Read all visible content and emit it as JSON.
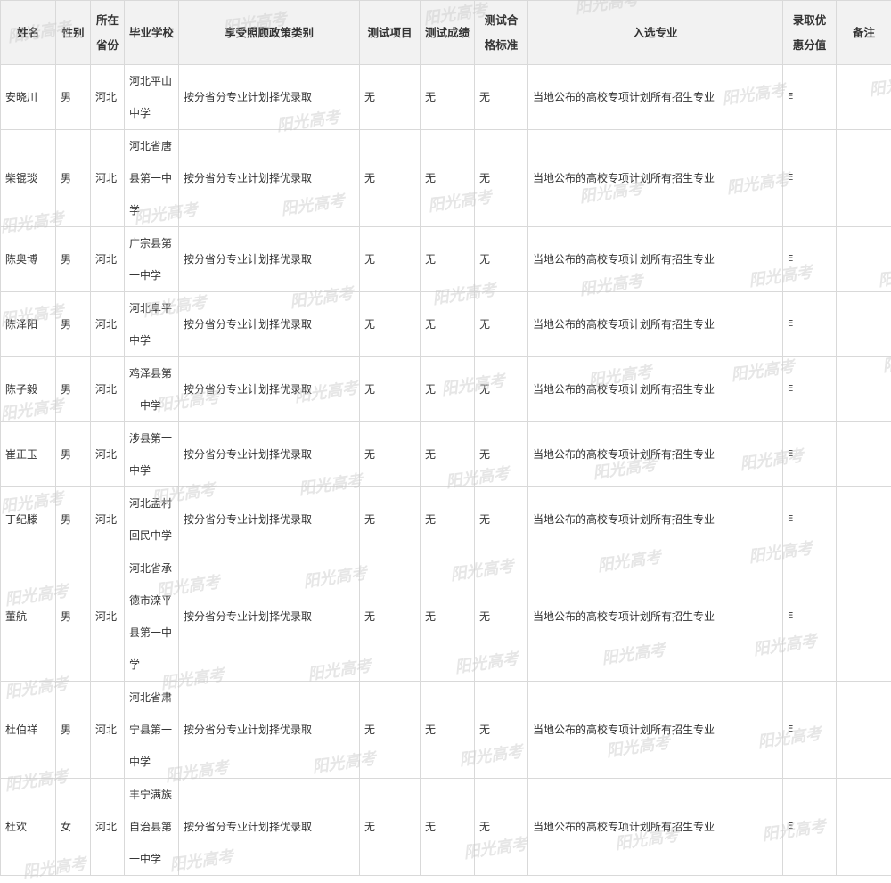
{
  "table": {
    "headers": [
      "姓名",
      "性别",
      "所在省份",
      "毕业学校",
      "享受照顾政策类别",
      "测试项目",
      "测试成绩",
      "测试合格标准",
      "入选专业",
      "录取优惠分值",
      "备注"
    ],
    "rows": [
      [
        "安晓川",
        "男",
        "河北",
        "河北平山中学",
        "按分省分专业计划择优录取",
        "无",
        "无",
        "无",
        "当地公布的高校专项计划所有招生专业",
        "E",
        ""
      ],
      [
        "柴锟琰",
        "男",
        "河北",
        "河北省唐县第一中学",
        "按分省分专业计划择优录取",
        "无",
        "无",
        "无",
        "当地公布的高校专项计划所有招生专业",
        "E",
        ""
      ],
      [
        "陈奥博",
        "男",
        "河北",
        "广宗县第一中学",
        "按分省分专业计划择优录取",
        "无",
        "无",
        "无",
        "当地公布的高校专项计划所有招生专业",
        "E",
        ""
      ],
      [
        "陈泽阳",
        "男",
        "河北",
        "河北阜平中学",
        "按分省分专业计划择优录取",
        "无",
        "无",
        "无",
        "当地公布的高校专项计划所有招生专业",
        "E",
        ""
      ],
      [
        "陈子毅",
        "男",
        "河北",
        "鸡泽县第一中学",
        "按分省分专业计划择优录取",
        "无",
        "无",
        "无",
        "当地公布的高校专项计划所有招生专业",
        "E",
        ""
      ],
      [
        "崔正玉",
        "男",
        "河北",
        "涉县第一中学",
        "按分省分专业计划择优录取",
        "无",
        "无",
        "无",
        "当地公布的高校专项计划所有招生专业",
        "E",
        ""
      ],
      [
        "丁纪滕",
        "男",
        "河北",
        "河北孟村回民中学",
        "按分省分专业计划择优录取",
        "无",
        "无",
        "无",
        "当地公布的高校专项计划所有招生专业",
        "E",
        ""
      ],
      [
        "董航",
        "男",
        "河北",
        "河北省承德市滦平县第一中学",
        "按分省分专业计划择优录取",
        "无",
        "无",
        "无",
        "当地公布的高校专项计划所有招生专业",
        "E",
        ""
      ],
      [
        "杜伯祥",
        "男",
        "河北",
        "河北省肃宁县第一中学",
        "按分省分专业计划择优录取",
        "无",
        "无",
        "无",
        "当地公布的高校专项计划所有招生专业",
        "E",
        ""
      ],
      [
        "杜欢",
        "女",
        "河北",
        "丰宁满族自治县第一中学",
        "按分省分专业计划择优录取",
        "无",
        "无",
        "无",
        "当地公布的高校专项计划所有招生专业",
        "E",
        ""
      ]
    ]
  },
  "watermark": "阳光高考"
}
